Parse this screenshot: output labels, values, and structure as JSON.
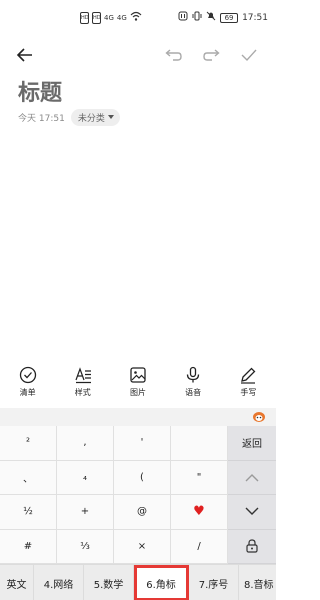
{
  "status_bar": {
    "sim1": "HD",
    "sim2": "HD",
    "signal1": "4G",
    "signal2": "4G",
    "battery": "69",
    "time": "17:51"
  },
  "toolbar": {
    "back_icon": "arrow-left-icon",
    "undo_icon": "undo-icon",
    "redo_icon": "redo-icon",
    "confirm_icon": "check-icon"
  },
  "note": {
    "title_placeholder": "标题",
    "date": "今天 17:51",
    "category": "未分类"
  },
  "tools": [
    {
      "label": "清单",
      "icon": "checklist-icon"
    },
    {
      "label": "样式",
      "icon": "text-style-icon"
    },
    {
      "label": "图片",
      "icon": "image-icon"
    },
    {
      "label": "语音",
      "icon": "microphone-icon"
    },
    {
      "label": "手写",
      "icon": "pen-icon"
    }
  ],
  "keyboard": {
    "keys": [
      "²",
      ",",
      "'",
      "",
      "、",
      "₄",
      "(",
      "\"",
      "½",
      "+",
      "@",
      "♥",
      "#",
      "⅓",
      "×",
      "/"
    ],
    "side": {
      "return": "返回",
      "up_icon": "chevron-up-icon",
      "down_icon": "chevron-down-icon",
      "lock_icon": "lock-icon"
    },
    "tabs": [
      {
        "label": "英文",
        "active": false
      },
      {
        "label": "4.网络",
        "active": false
      },
      {
        "label": "5.数学",
        "active": false
      },
      {
        "label": "6.角标",
        "active": true
      },
      {
        "label": "7.序号",
        "active": false
      },
      {
        "label": "8.音标",
        "active": false
      }
    ],
    "colors": {
      "highlight": "#e53935",
      "heart": "#e02020"
    }
  }
}
